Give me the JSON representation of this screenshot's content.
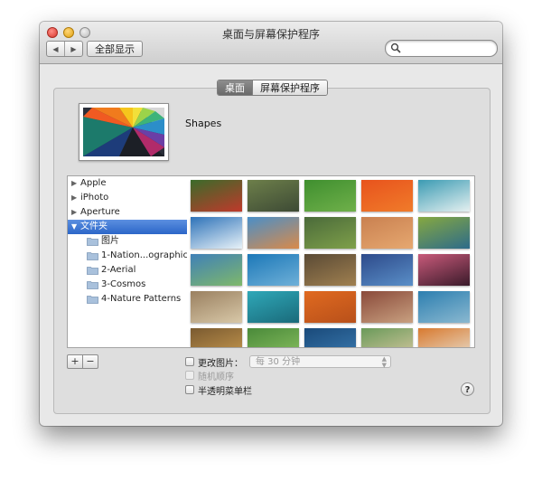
{
  "window": {
    "title": "桌面与屏幕保护程序"
  },
  "toolbar": {
    "back_label": "◀",
    "forward_label": "▶",
    "show_all_label": "全部显示",
    "search_value": ""
  },
  "tabs": [
    {
      "label": "桌面",
      "active": true
    },
    {
      "label": "屏幕保护程序",
      "active": false
    }
  ],
  "preview": {
    "name": "Shapes"
  },
  "sidebar": {
    "items": [
      {
        "label": "Apple",
        "disclosure": "▶",
        "selected": false,
        "level": 0
      },
      {
        "label": "iPhoto",
        "disclosure": "▶",
        "selected": false,
        "level": 0
      },
      {
        "label": "Aperture",
        "disclosure": "▶",
        "selected": false,
        "level": 0
      },
      {
        "label": "文件夹",
        "disclosure": "▼",
        "selected": true,
        "level": 0
      },
      {
        "label": "图片",
        "level": 1
      },
      {
        "label": "1-Nation...ographic",
        "level": 1
      },
      {
        "label": "2-Aerial",
        "level": 1
      },
      {
        "label": "3-Cosmos",
        "level": 1
      },
      {
        "label": "4-Nature Patterns",
        "level": 1
      }
    ]
  },
  "thumbnails": [
    [
      "#3a6b2a",
      "#c0392b"
    ],
    [
      "#6d7f4a",
      "#3d4a35"
    ],
    [
      "#3f8f2f",
      "#6fb04a"
    ],
    [
      "#e8531d",
      "#f07b2a"
    ],
    [
      "#3b9bb3",
      "#e5f0f0"
    ],
    [
      "#2d72b8",
      "#e8f2f8"
    ],
    [
      "#4a8fc8",
      "#d98a4a"
    ],
    [
      "#4a6a3a",
      "#7fa04a"
    ],
    [
      "#c98050",
      "#e6a870"
    ],
    [
      "#86a840",
      "#2d6b8a"
    ],
    [
      "#3f80b8",
      "#7fb86a"
    ],
    [
      "#1c78b8",
      "#6fb0d8"
    ],
    [
      "#5a4a35",
      "#a08050"
    ],
    [
      "#2d4a8a",
      "#5a8fc8"
    ],
    [
      "#c85a7a",
      "#3a1a2a"
    ],
    [
      "#9a8060",
      "#d8c8a8"
    ],
    [
      "#2fa8b8",
      "#1a6a7a"
    ],
    [
      "#e06a20",
      "#b8501a"
    ],
    [
      "#8a4a3a",
      "#c8a080"
    ],
    [
      "#2d7fb0",
      "#8ab8d0"
    ],
    [
      "#7a5a30",
      "#c89a50"
    ],
    [
      "#4a8a3a",
      "#8ac060"
    ],
    [
      "#1a4a7a",
      "#3a7ab0"
    ],
    [
      "#6a9a5a",
      "#d8c8a0"
    ],
    [
      "#d87a30",
      "#e8e0d0"
    ]
  ],
  "controls": {
    "add_label": "+",
    "remove_label": "−",
    "change_picture_label": "更改图片：",
    "interval_value": "每 30 分钟",
    "random_order_label": "随机顺序",
    "translucent_menu_label": "半透明菜单栏",
    "help_label": "?"
  },
  "colors": {
    "selection": "#2c66c8",
    "active_tab": "#6a6a6a"
  }
}
